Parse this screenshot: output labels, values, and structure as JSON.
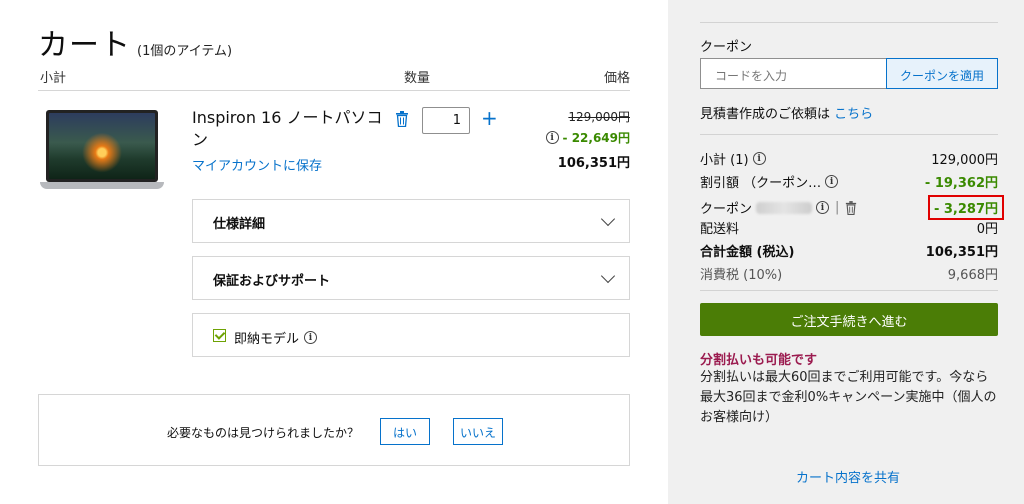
{
  "cart": {
    "title": "カート",
    "item_count": "(1個のアイテム)",
    "headers": {
      "subtotal": "小計",
      "quantity": "数量",
      "price": "価格"
    }
  },
  "item": {
    "name": "Inspiron 16 ノートパソコン",
    "save_link": "マイアカウントに保存",
    "quantity": "1",
    "price_original": "129,000円",
    "price_discount": "- 22,649円",
    "price_final": "106,351円"
  },
  "accordions": [
    {
      "label": "仕様詳細"
    },
    {
      "label": "保証およびサポート"
    }
  ],
  "quick_model": {
    "label": "即納モデル"
  },
  "feedback": {
    "question": "必要なものは見つけられましたか？",
    "yes": "はい",
    "no": "いいえ"
  },
  "summary": {
    "coupon_label": "クーポン",
    "coupon_placeholder": "コードを入力",
    "coupon_apply": "クーポンを適用",
    "quote_text": "見積書作成のご依頼は",
    "quote_link": "こちら",
    "rows": {
      "subtotal_label": "小計 (1)",
      "subtotal_value": "129,000円",
      "discount_label": "割引額 （クーポン…",
      "discount_value": "- 19,362円",
      "coupon_label": "クーポン",
      "coupon_value": "- 3,287円",
      "shipping_label": "配送料",
      "shipping_value": "0円",
      "total_label": "合計金額 (税込)",
      "total_value": "106,351円",
      "tax_label": "消費税 (10%)",
      "tax_value": "9,668円"
    },
    "checkout": "ご注文手続きへ進む",
    "installment_title": "分割払いも可能です",
    "installment_text": "分割払いは最大60回までご利用可能です。今なら最大36回まで金利0%キャンペーン実施中（個人のお客様向け）",
    "share": "カート内容を共有"
  },
  "colors": {
    "link_blue": "#0672cb",
    "discount_green": "#3a8a00",
    "checkout_green": "#4b7d06",
    "installment_red": "#9b1b4f",
    "highlight_red": "#e00000"
  }
}
